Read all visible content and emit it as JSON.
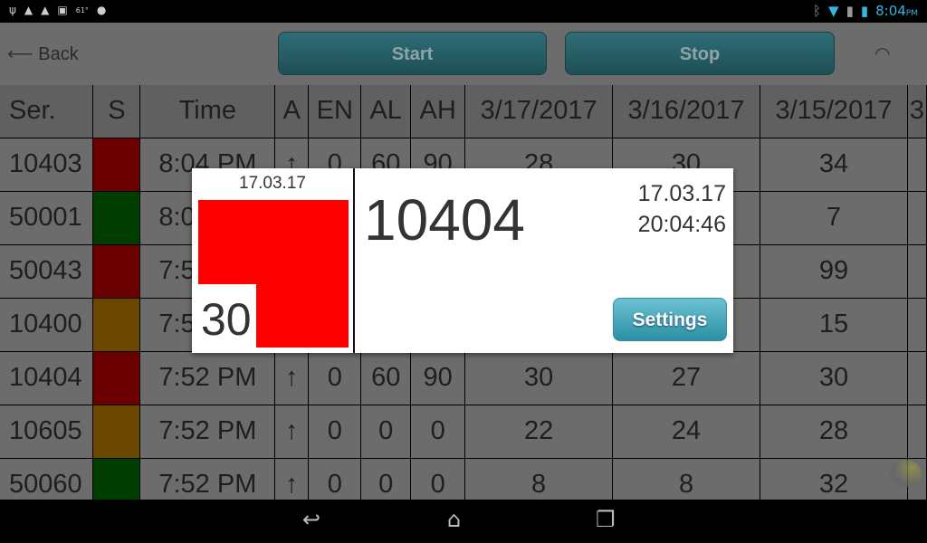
{
  "status_bar": {
    "left_icons": [
      "usb-icon",
      "warning-icon",
      "warning-icon",
      "image-icon",
      "temperature-61",
      "android-icon"
    ],
    "temp": "61°",
    "time": "8:04",
    "ampm": "PM"
  },
  "appbar": {
    "back": "Back",
    "start": "Start",
    "stop": "Stop"
  },
  "table": {
    "headers": [
      "Ser.",
      "S",
      "Time",
      "A",
      "EN",
      "AL",
      "AH",
      "3/17/2017",
      "3/16/2017",
      "3/15/2017",
      "3"
    ],
    "status_colors": {
      "red": "#6b0000",
      "green": "#003d00",
      "orange": "#6b4800"
    },
    "rows": [
      {
        "ser": "10403",
        "s": "red",
        "time": "8:04 PM",
        "a": "↑",
        "en": "0",
        "al": "60",
        "ah": "90",
        "d1": "28",
        "d2": "30",
        "d3": "34"
      },
      {
        "ser": "50001",
        "s": "green",
        "time": "8:04 PM",
        "a": "",
        "en": "",
        "al": "",
        "ah": "",
        "d1": "",
        "d2": "",
        "d3": "7"
      },
      {
        "ser": "50043",
        "s": "red",
        "time": "7:52 PM",
        "a": "",
        "en": "",
        "al": "",
        "ah": "",
        "d1": "",
        "d2": "",
        "d3": "99"
      },
      {
        "ser": "10400",
        "s": "orange",
        "time": "7:52 PM",
        "a": "",
        "en": "",
        "al": "",
        "ah": "",
        "d1": "",
        "d2": "",
        "d3": "15"
      },
      {
        "ser": "10404",
        "s": "red",
        "time": "7:52 PM",
        "a": "↑",
        "en": "0",
        "al": "60",
        "ah": "90",
        "d1": "30",
        "d2": "27",
        "d3": "30"
      },
      {
        "ser": "10605",
        "s": "orange",
        "time": "7:52 PM",
        "a": "↑",
        "en": "0",
        "al": "0",
        "ah": "0",
        "d1": "22",
        "d2": "24",
        "d3": "28"
      },
      {
        "ser": "50060",
        "s": "green",
        "time": "7:52 PM",
        "a": "↑",
        "en": "0",
        "al": "0",
        "ah": "0",
        "d1": "8",
        "d2": "8",
        "d3": "32"
      }
    ]
  },
  "dialog": {
    "small_date": "17.03.17",
    "value": "30",
    "serial": "10404",
    "date": "17.03.17",
    "time": "20:04:46",
    "settings": "Settings",
    "alarm_color": "#ff0000"
  }
}
